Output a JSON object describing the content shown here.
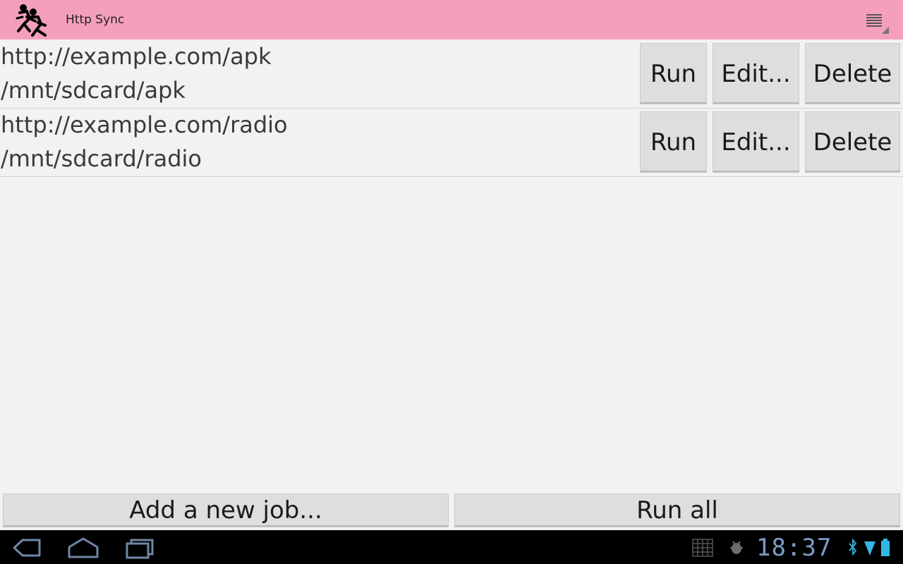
{
  "app": {
    "title": "Http Sync",
    "icon": "running-people-icon",
    "menu_icon": "overflow-menu-icon"
  },
  "jobs": [
    {
      "url": "http://example.com/apk",
      "path": "/mnt/sdcard/apk",
      "run_label": "Run",
      "edit_label": "Edit...",
      "delete_label": "Delete"
    },
    {
      "url": "http://example.com/radio",
      "path": "/mnt/sdcard/radio",
      "run_label": "Run",
      "edit_label": "Edit...",
      "delete_label": "Delete"
    }
  ],
  "footer": {
    "add_label": "Add a new job...",
    "run_all_label": "Run all"
  },
  "system_bar": {
    "time": "18:37",
    "nav_icons": [
      "back-icon",
      "home-icon",
      "recent-apps-icon"
    ],
    "status_icons": [
      "screenshot-grid-icon",
      "usb-debugging-icon",
      "bluetooth-icon",
      "wifi-icon",
      "battery-icon"
    ]
  },
  "colors": {
    "action_bar": "#f5a0bb",
    "background": "#f2f2f2",
    "button": "#dedede",
    "system_bar": "#000000",
    "clock": "#7a9cc4"
  }
}
